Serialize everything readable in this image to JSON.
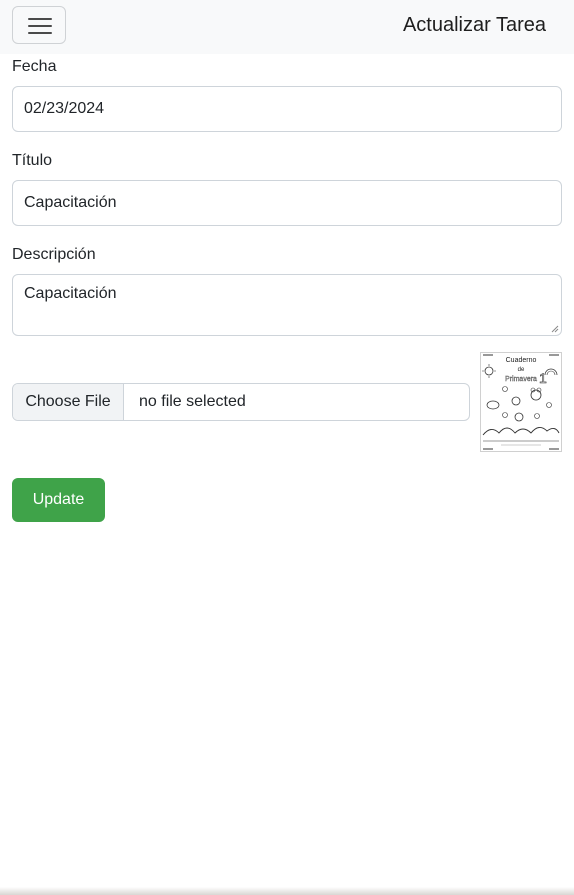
{
  "navbar": {
    "title": "Actualizar Tarea",
    "menu_icon": "hamburger-menu-icon"
  },
  "form": {
    "date": {
      "label": "Fecha",
      "value": "02/23/2024"
    },
    "title": {
      "label": "Título",
      "value": "Capacitación"
    },
    "description": {
      "label": "Descripción",
      "value": "Capacitación"
    },
    "file": {
      "button_label": "Choose File",
      "status": "no file selected"
    },
    "thumbnail": {
      "heading_1": "Cuaderno",
      "heading_2": "de",
      "heading_3": "Primavera",
      "grade": "1"
    },
    "submit_label": "Update"
  },
  "colors": {
    "navbar_bg": "#f8f9fa",
    "primary_button": "#3fa349",
    "border": "#ced4da"
  }
}
